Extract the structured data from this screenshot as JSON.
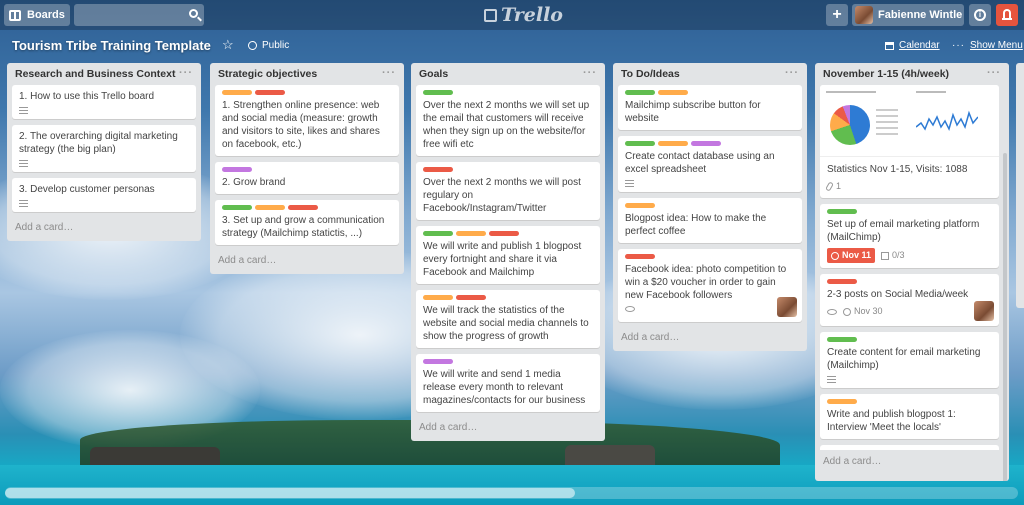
{
  "header": {
    "boards_label": "Boards",
    "search_value": "",
    "logo_text": "Trello",
    "add_label": "+",
    "user_name": "Fabienne Wintle",
    "info_label": "i"
  },
  "board": {
    "title": "Tourism Tribe Training Template",
    "star": "☆",
    "visibility": "Public",
    "calendar_label": "Calendar",
    "menu_dots": "···",
    "show_menu_label": "Show Menu"
  },
  "lists": [
    {
      "title": "Research and Business Context",
      "menu": "···",
      "add_card": "Add a card…",
      "cards": [
        {
          "text": "1. How to use this Trello board"
        },
        {
          "text": "2. The overarching digital marketing strategy (the big plan)"
        },
        {
          "text": "3. Develop customer personas"
        }
      ]
    },
    {
      "title": "Strategic objectives",
      "menu": "···",
      "add_card": "Add a card…",
      "cards": [
        {
          "text": "1. Strengthen online presence: web and social media (measure: growth and visitors to site, likes and shares on facebook, etc.)",
          "labels": [
            "orange",
            "red"
          ]
        },
        {
          "text": "2. Grow brand",
          "labels": [
            "purple"
          ]
        },
        {
          "text": "3. Set up and grow a communication strategy (Mailchimp statictis, ...)",
          "labels": [
            "green",
            "orange",
            "red"
          ]
        }
      ]
    },
    {
      "title": "Goals",
      "menu": "···",
      "add_card": "Add a card…",
      "cards": [
        {
          "text": "Over the next 2 months we will set up the email that customers will receive when they sign up on the website/for free wifi etc",
          "labels": [
            "green"
          ]
        },
        {
          "text": "Over the next 2 months we will post regulary on Facebook/Instagram/Twitter",
          "labels": [
            "red"
          ]
        },
        {
          "text": "We will write and publish 1 blogpost every fortnight and share it via Facebook and Mailchimp",
          "labels": [
            "green",
            "orange",
            "red"
          ]
        },
        {
          "text": "We will track the statistics of the website and social media channels to show the progress of growth",
          "labels": [
            "orange",
            "red"
          ]
        },
        {
          "text": "We will write and send 1 media release every month to relevant magazines/contacts for our business",
          "labels": [
            "purple"
          ]
        }
      ]
    },
    {
      "title": "To Do/Ideas",
      "menu": "···",
      "add_card": "Add a card…",
      "cards": [
        {
          "text": "Mailchimp subscribe button for website",
          "labels": [
            "green",
            "orange"
          ]
        },
        {
          "text": "Create contact database using an excel spreadsheet",
          "labels": [
            "green",
            "orange",
            "purple"
          ]
        },
        {
          "text": "Blogpost idea: How to make the perfect coffee",
          "labels": [
            "orange"
          ]
        },
        {
          "text": "Facebook idea: photo competition to win a $20 voucher in order to gain new Facebook followers",
          "labels": [
            "red"
          ]
        }
      ]
    },
    {
      "title": "November 1-15 (4h/week)",
      "menu": "···",
      "add_card": "Add a card…",
      "cards": [
        {
          "text": "Statistics Nov 1-15, Visits: 1088",
          "attachments": "1"
        },
        {
          "text": "Set up of email marketing platform (MailChimp)",
          "labels": [
            "green"
          ],
          "due": "Nov 11",
          "checklist": "0/3"
        },
        {
          "text": "2-3 posts on Social Media/week",
          "labels": [
            "red"
          ],
          "due": "Nov 30"
        },
        {
          "text": "Create content for email marketing (Mailchimp)",
          "labels": [
            "green"
          ]
        },
        {
          "text": "Write and publish blogpost 1: Interview 'Meet the locals'",
          "labels": [
            "orange"
          ]
        }
      ]
    }
  ],
  "colors": {
    "green": "#61bd4f",
    "orange": "#ffab4a",
    "red": "#eb5a46",
    "purple": "#c377e0",
    "list_bg": "#e2e4e6"
  }
}
